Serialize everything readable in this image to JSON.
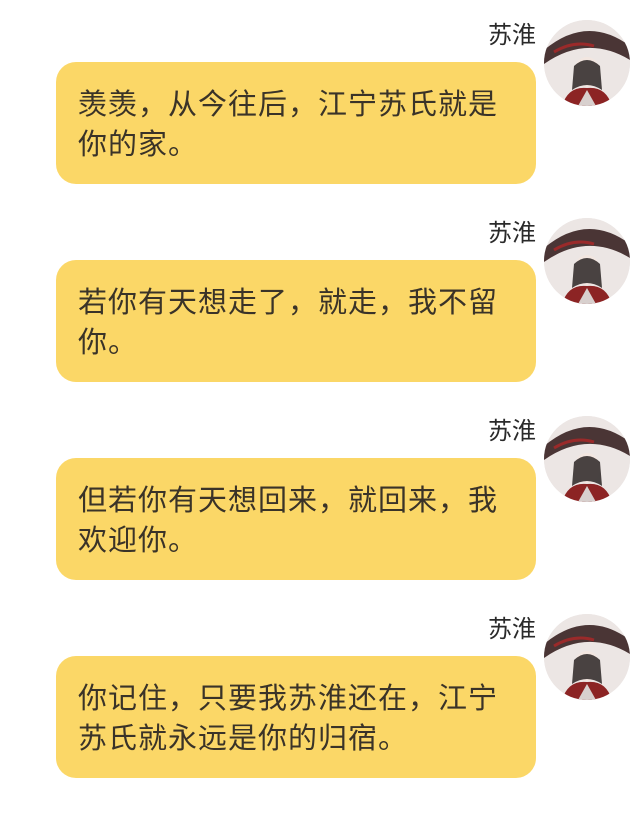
{
  "chat": {
    "messages": [
      {
        "sender": "苏淮",
        "text": "羡羡，从今往后，江宁苏氏就是你的家。",
        "avatar_icon": "user-avatar-icon"
      },
      {
        "sender": "苏淮",
        "text": "若你有天想走了，就走，我不留你。",
        "avatar_icon": "user-avatar-icon"
      },
      {
        "sender": "苏淮",
        "text": "但若你有天想回来，就回来，我欢迎你。",
        "avatar_icon": "user-avatar-icon"
      },
      {
        "sender": "苏淮",
        "text": "你记住，只要我苏淮还在，江宁苏氏就永远是你的归宿。",
        "avatar_icon": "user-avatar-icon"
      }
    ]
  },
  "colors": {
    "bubble": "#fbd767",
    "text": "#3a3328",
    "background": "#ffffff"
  }
}
